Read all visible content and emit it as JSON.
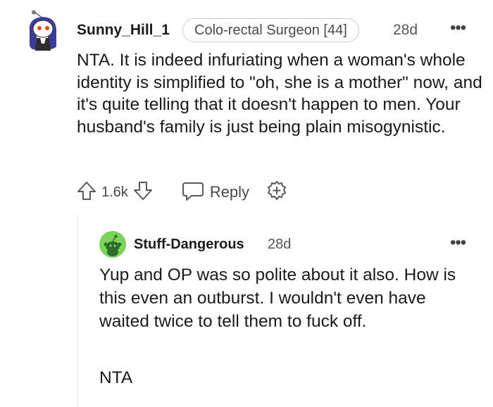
{
  "comment": {
    "username": "Sunny_Hill_1",
    "flair": "Colo-rectal Surgeon [44]",
    "time": "28d",
    "more": "•••",
    "body": "NTA. It is indeed infuriating when a woman's whole identity is simplified to \"oh, she is a mother\" now, and it's quite telling that it doesn't happen to men. Your husband's family is just being plain misogynistic.",
    "votes": "1.6k",
    "reply_label": "Reply",
    "avatar": "snoo-avatar-icon"
  },
  "reply": {
    "username": "Stuff-Dangerous",
    "time": "28d",
    "more": "•••",
    "body_p1": "Yup and OP was so polite about it also. How is this even an outburst. I wouldn't even have waited twice to tell them to fuck off.",
    "body_p2": "NTA",
    "avatar": "snoo-avatar-icon"
  },
  "colors": {
    "text": "#1a1a1b",
    "muted": "#555555",
    "reply_avatar_bg": "#7bd35a",
    "thread_line": "#e4e4e4"
  }
}
